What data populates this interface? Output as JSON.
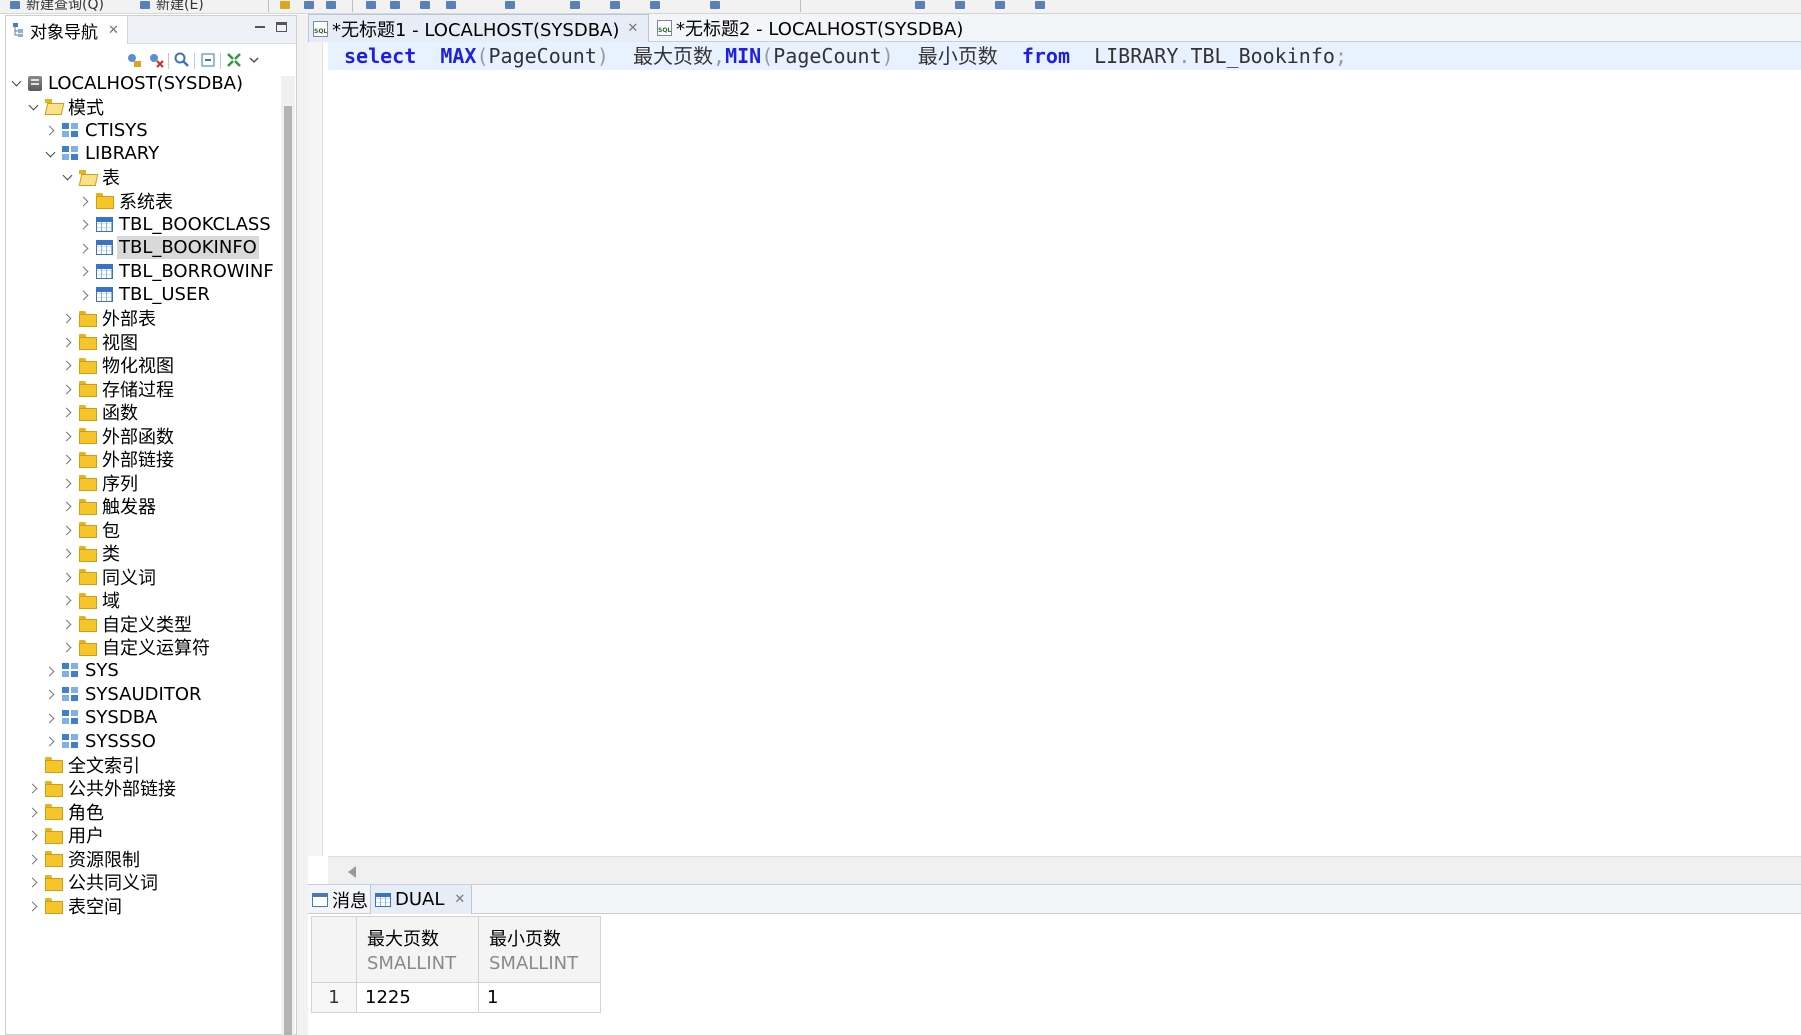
{
  "top_strip": {
    "fragments": [
      "新建查询(Q)",
      "新建(E)"
    ]
  },
  "navigator": {
    "tab_label": "对象导航",
    "tree": [
      {
        "label": "LOCALHOST(SYSDBA)",
        "level": 0,
        "state": "expanded",
        "icon": "database-server-icon"
      },
      {
        "label": "模式",
        "level": 1,
        "state": "expanded",
        "icon": "folder-open-icon"
      },
      {
        "label": "CTISYS",
        "level": 2,
        "state": "collapsed",
        "icon": "schema-icon"
      },
      {
        "label": "LIBRARY",
        "level": 2,
        "state": "expanded",
        "icon": "schema-icon"
      },
      {
        "label": "表",
        "level": 3,
        "state": "expanded",
        "icon": "folder-open-icon"
      },
      {
        "label": "系统表",
        "level": 4,
        "state": "collapsed",
        "icon": "folder-icon"
      },
      {
        "label": "TBL_BOOKCLASS",
        "level": 4,
        "state": "collapsed",
        "icon": "table-icon"
      },
      {
        "label": "TBL_BOOKINFO",
        "level": 4,
        "state": "collapsed",
        "icon": "table-icon",
        "selected": true
      },
      {
        "label": "TBL_BORROWINF",
        "level": 4,
        "state": "collapsed",
        "icon": "table-icon"
      },
      {
        "label": "TBL_USER",
        "level": 4,
        "state": "collapsed",
        "icon": "table-icon"
      },
      {
        "label": "外部表",
        "level": 3,
        "state": "collapsed",
        "icon": "folder-icon"
      },
      {
        "label": "视图",
        "level": 3,
        "state": "collapsed",
        "icon": "folder-icon"
      },
      {
        "label": "物化视图",
        "level": 3,
        "state": "collapsed",
        "icon": "folder-icon"
      },
      {
        "label": "存储过程",
        "level": 3,
        "state": "collapsed",
        "icon": "folder-icon"
      },
      {
        "label": "函数",
        "level": 3,
        "state": "collapsed",
        "icon": "folder-icon"
      },
      {
        "label": "外部函数",
        "level": 3,
        "state": "collapsed",
        "icon": "folder-icon"
      },
      {
        "label": "外部链接",
        "level": 3,
        "state": "collapsed",
        "icon": "folder-icon"
      },
      {
        "label": "序列",
        "level": 3,
        "state": "collapsed",
        "icon": "folder-icon"
      },
      {
        "label": "触发器",
        "level": 3,
        "state": "collapsed",
        "icon": "folder-icon"
      },
      {
        "label": "包",
        "level": 3,
        "state": "collapsed",
        "icon": "folder-icon"
      },
      {
        "label": "类",
        "level": 3,
        "state": "collapsed",
        "icon": "folder-icon"
      },
      {
        "label": "同义词",
        "level": 3,
        "state": "collapsed",
        "icon": "folder-icon"
      },
      {
        "label": "域",
        "level": 3,
        "state": "collapsed",
        "icon": "folder-icon"
      },
      {
        "label": "自定义类型",
        "level": 3,
        "state": "collapsed",
        "icon": "folder-icon"
      },
      {
        "label": "自定义运算符",
        "level": 3,
        "state": "collapsed",
        "icon": "folder-icon"
      },
      {
        "label": "SYS",
        "level": 2,
        "state": "collapsed",
        "icon": "schema-icon"
      },
      {
        "label": "SYSAUDITOR",
        "level": 2,
        "state": "collapsed",
        "icon": "schema-icon"
      },
      {
        "label": "SYSDBA",
        "level": 2,
        "state": "collapsed",
        "icon": "schema-icon"
      },
      {
        "label": "SYSSSO",
        "level": 2,
        "state": "collapsed",
        "icon": "schema-icon"
      },
      {
        "label": "全文索引",
        "level": 1,
        "state": "none",
        "icon": "folder-icon"
      },
      {
        "label": "公共外部链接",
        "level": 1,
        "state": "collapsed",
        "icon": "folder-icon"
      },
      {
        "label": "角色",
        "level": 1,
        "state": "collapsed",
        "icon": "folder-icon"
      },
      {
        "label": "用户",
        "level": 1,
        "state": "collapsed",
        "icon": "folder-icon"
      },
      {
        "label": "资源限制",
        "level": 1,
        "state": "collapsed",
        "icon": "folder-icon"
      },
      {
        "label": "公共同义词",
        "level": 1,
        "state": "collapsed",
        "icon": "folder-icon"
      },
      {
        "label": "表空间",
        "level": 1,
        "state": "collapsed",
        "icon": "folder-icon"
      }
    ]
  },
  "editor": {
    "tabs": [
      {
        "label": "*无标题1 - LOCALHOST(SYSDBA)",
        "active": true
      },
      {
        "label": "*无标题2 - LOCALHOST(SYSDBA)",
        "active": false
      }
    ],
    "sql_tokens": [
      {
        "t": "select",
        "c": "kw"
      },
      {
        "t": "  ",
        "c": "txt"
      },
      {
        "t": "MAX",
        "c": "kw"
      },
      {
        "t": "(",
        "c": "pun"
      },
      {
        "t": "PageCount",
        "c": "txt"
      },
      {
        "t": ")",
        "c": "pun"
      },
      {
        "t": "  最大页数",
        "c": "txt"
      },
      {
        "t": ",",
        "c": "pun"
      },
      {
        "t": "MIN",
        "c": "kw"
      },
      {
        "t": "(",
        "c": "pun"
      },
      {
        "t": "PageCount",
        "c": "txt"
      },
      {
        "t": ")",
        "c": "pun"
      },
      {
        "t": "  最小页数  ",
        "c": "txt"
      },
      {
        "t": "from",
        "c": "kw"
      },
      {
        "t": "  LIBRARY",
        "c": "txt"
      },
      {
        "t": ".",
        "c": "pun"
      },
      {
        "t": "TBL_Bookinfo",
        "c": "txt"
      },
      {
        "t": ";",
        "c": "pun"
      }
    ],
    "colors": {
      "keyword": "#1f1fe0",
      "punctuation": "#9a9a9a",
      "current_line": "#e8f2fe"
    }
  },
  "results": {
    "tabs": [
      {
        "label": "消息",
        "icon": "message-icon",
        "active": false
      },
      {
        "label": "DUAL",
        "icon": "grid-icon",
        "active": true
      }
    ],
    "columns": [
      {
        "name": "最大页数",
        "type": "SMALLINT"
      },
      {
        "name": "最小页数",
        "type": "SMALLINT"
      }
    ],
    "rows": [
      {
        "num": "1",
        "cells": [
          "1225",
          "1"
        ]
      }
    ]
  }
}
